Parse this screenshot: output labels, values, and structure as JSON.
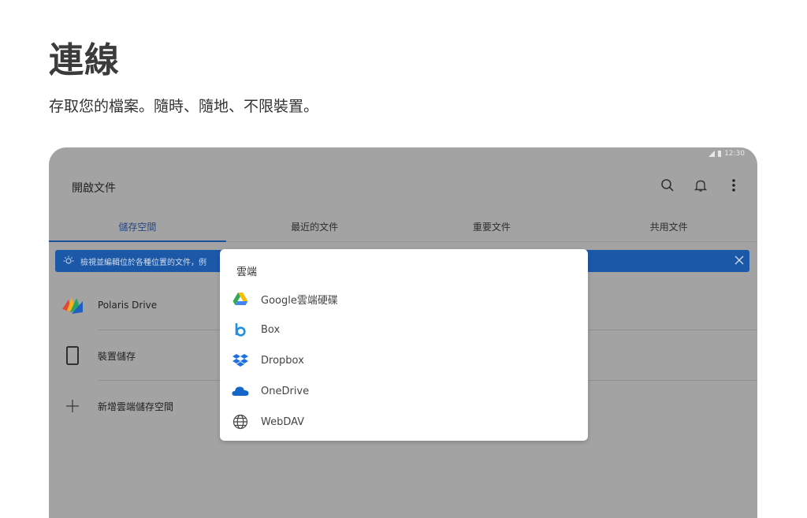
{
  "promo": {
    "title": "連線",
    "subtitle": "存取您的檔案。隨時、隨地、不限裝置。"
  },
  "status_bar": {
    "time": "12:30"
  },
  "app_bar": {
    "title": "開啟文件",
    "icons": [
      "search-icon",
      "bell-icon",
      "more-vert-icon"
    ]
  },
  "tabs": [
    {
      "label": "儲存空間",
      "active": true
    },
    {
      "label": "最近的文件",
      "active": false
    },
    {
      "label": "重要文件",
      "active": false
    },
    {
      "label": "共用文件",
      "active": false
    }
  ],
  "banner": {
    "text": "檢視並編輯位於各種位置的文件，例",
    "color": "#1c58a8"
  },
  "storage_list": [
    {
      "label": "Polaris Drive",
      "icon": "polaris-logo-icon"
    },
    {
      "label": "裝置儲存",
      "icon": "phone-icon"
    },
    {
      "label": "新增雲端儲存空間",
      "icon": "plus-icon"
    }
  ],
  "cloud_popup": {
    "title": "雲端",
    "options": [
      {
        "label": "Google雲端硬碟",
        "icon": "google-drive-icon"
      },
      {
        "label": "Box",
        "icon": "box-icon"
      },
      {
        "label": "Dropbox",
        "icon": "dropbox-icon"
      },
      {
        "label": "OneDrive",
        "icon": "onedrive-icon"
      },
      {
        "label": "WebDAV",
        "icon": "globe-icon"
      }
    ]
  }
}
